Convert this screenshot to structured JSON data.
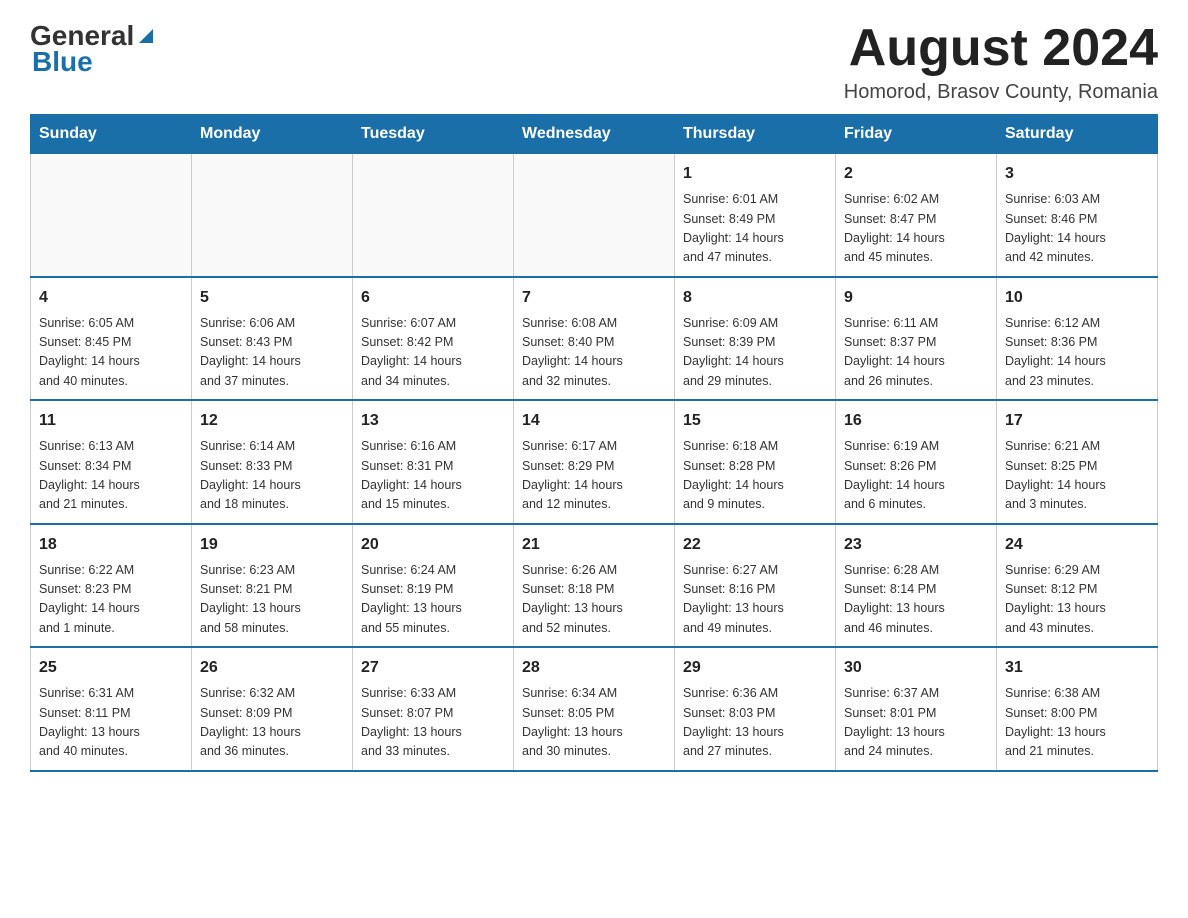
{
  "header": {
    "logo_general": "General",
    "logo_blue": "Blue",
    "month_title": "August 2024",
    "location": "Homorod, Brasov County, Romania"
  },
  "weekdays": [
    "Sunday",
    "Monday",
    "Tuesday",
    "Wednesday",
    "Thursday",
    "Friday",
    "Saturday"
  ],
  "weeks": [
    [
      {
        "day": "",
        "info": ""
      },
      {
        "day": "",
        "info": ""
      },
      {
        "day": "",
        "info": ""
      },
      {
        "day": "",
        "info": ""
      },
      {
        "day": "1",
        "info": "Sunrise: 6:01 AM\nSunset: 8:49 PM\nDaylight: 14 hours\nand 47 minutes."
      },
      {
        "day": "2",
        "info": "Sunrise: 6:02 AM\nSunset: 8:47 PM\nDaylight: 14 hours\nand 45 minutes."
      },
      {
        "day": "3",
        "info": "Sunrise: 6:03 AM\nSunset: 8:46 PM\nDaylight: 14 hours\nand 42 minutes."
      }
    ],
    [
      {
        "day": "4",
        "info": "Sunrise: 6:05 AM\nSunset: 8:45 PM\nDaylight: 14 hours\nand 40 minutes."
      },
      {
        "day": "5",
        "info": "Sunrise: 6:06 AM\nSunset: 8:43 PM\nDaylight: 14 hours\nand 37 minutes."
      },
      {
        "day": "6",
        "info": "Sunrise: 6:07 AM\nSunset: 8:42 PM\nDaylight: 14 hours\nand 34 minutes."
      },
      {
        "day": "7",
        "info": "Sunrise: 6:08 AM\nSunset: 8:40 PM\nDaylight: 14 hours\nand 32 minutes."
      },
      {
        "day": "8",
        "info": "Sunrise: 6:09 AM\nSunset: 8:39 PM\nDaylight: 14 hours\nand 29 minutes."
      },
      {
        "day": "9",
        "info": "Sunrise: 6:11 AM\nSunset: 8:37 PM\nDaylight: 14 hours\nand 26 minutes."
      },
      {
        "day": "10",
        "info": "Sunrise: 6:12 AM\nSunset: 8:36 PM\nDaylight: 14 hours\nand 23 minutes."
      }
    ],
    [
      {
        "day": "11",
        "info": "Sunrise: 6:13 AM\nSunset: 8:34 PM\nDaylight: 14 hours\nand 21 minutes."
      },
      {
        "day": "12",
        "info": "Sunrise: 6:14 AM\nSunset: 8:33 PM\nDaylight: 14 hours\nand 18 minutes."
      },
      {
        "day": "13",
        "info": "Sunrise: 6:16 AM\nSunset: 8:31 PM\nDaylight: 14 hours\nand 15 minutes."
      },
      {
        "day": "14",
        "info": "Sunrise: 6:17 AM\nSunset: 8:29 PM\nDaylight: 14 hours\nand 12 minutes."
      },
      {
        "day": "15",
        "info": "Sunrise: 6:18 AM\nSunset: 8:28 PM\nDaylight: 14 hours\nand 9 minutes."
      },
      {
        "day": "16",
        "info": "Sunrise: 6:19 AM\nSunset: 8:26 PM\nDaylight: 14 hours\nand 6 minutes."
      },
      {
        "day": "17",
        "info": "Sunrise: 6:21 AM\nSunset: 8:25 PM\nDaylight: 14 hours\nand 3 minutes."
      }
    ],
    [
      {
        "day": "18",
        "info": "Sunrise: 6:22 AM\nSunset: 8:23 PM\nDaylight: 14 hours\nand 1 minute."
      },
      {
        "day": "19",
        "info": "Sunrise: 6:23 AM\nSunset: 8:21 PM\nDaylight: 13 hours\nand 58 minutes."
      },
      {
        "day": "20",
        "info": "Sunrise: 6:24 AM\nSunset: 8:19 PM\nDaylight: 13 hours\nand 55 minutes."
      },
      {
        "day": "21",
        "info": "Sunrise: 6:26 AM\nSunset: 8:18 PM\nDaylight: 13 hours\nand 52 minutes."
      },
      {
        "day": "22",
        "info": "Sunrise: 6:27 AM\nSunset: 8:16 PM\nDaylight: 13 hours\nand 49 minutes."
      },
      {
        "day": "23",
        "info": "Sunrise: 6:28 AM\nSunset: 8:14 PM\nDaylight: 13 hours\nand 46 minutes."
      },
      {
        "day": "24",
        "info": "Sunrise: 6:29 AM\nSunset: 8:12 PM\nDaylight: 13 hours\nand 43 minutes."
      }
    ],
    [
      {
        "day": "25",
        "info": "Sunrise: 6:31 AM\nSunset: 8:11 PM\nDaylight: 13 hours\nand 40 minutes."
      },
      {
        "day": "26",
        "info": "Sunrise: 6:32 AM\nSunset: 8:09 PM\nDaylight: 13 hours\nand 36 minutes."
      },
      {
        "day": "27",
        "info": "Sunrise: 6:33 AM\nSunset: 8:07 PM\nDaylight: 13 hours\nand 33 minutes."
      },
      {
        "day": "28",
        "info": "Sunrise: 6:34 AM\nSunset: 8:05 PM\nDaylight: 13 hours\nand 30 minutes."
      },
      {
        "day": "29",
        "info": "Sunrise: 6:36 AM\nSunset: 8:03 PM\nDaylight: 13 hours\nand 27 minutes."
      },
      {
        "day": "30",
        "info": "Sunrise: 6:37 AM\nSunset: 8:01 PM\nDaylight: 13 hours\nand 24 minutes."
      },
      {
        "day": "31",
        "info": "Sunrise: 6:38 AM\nSunset: 8:00 PM\nDaylight: 13 hours\nand 21 minutes."
      }
    ]
  ]
}
